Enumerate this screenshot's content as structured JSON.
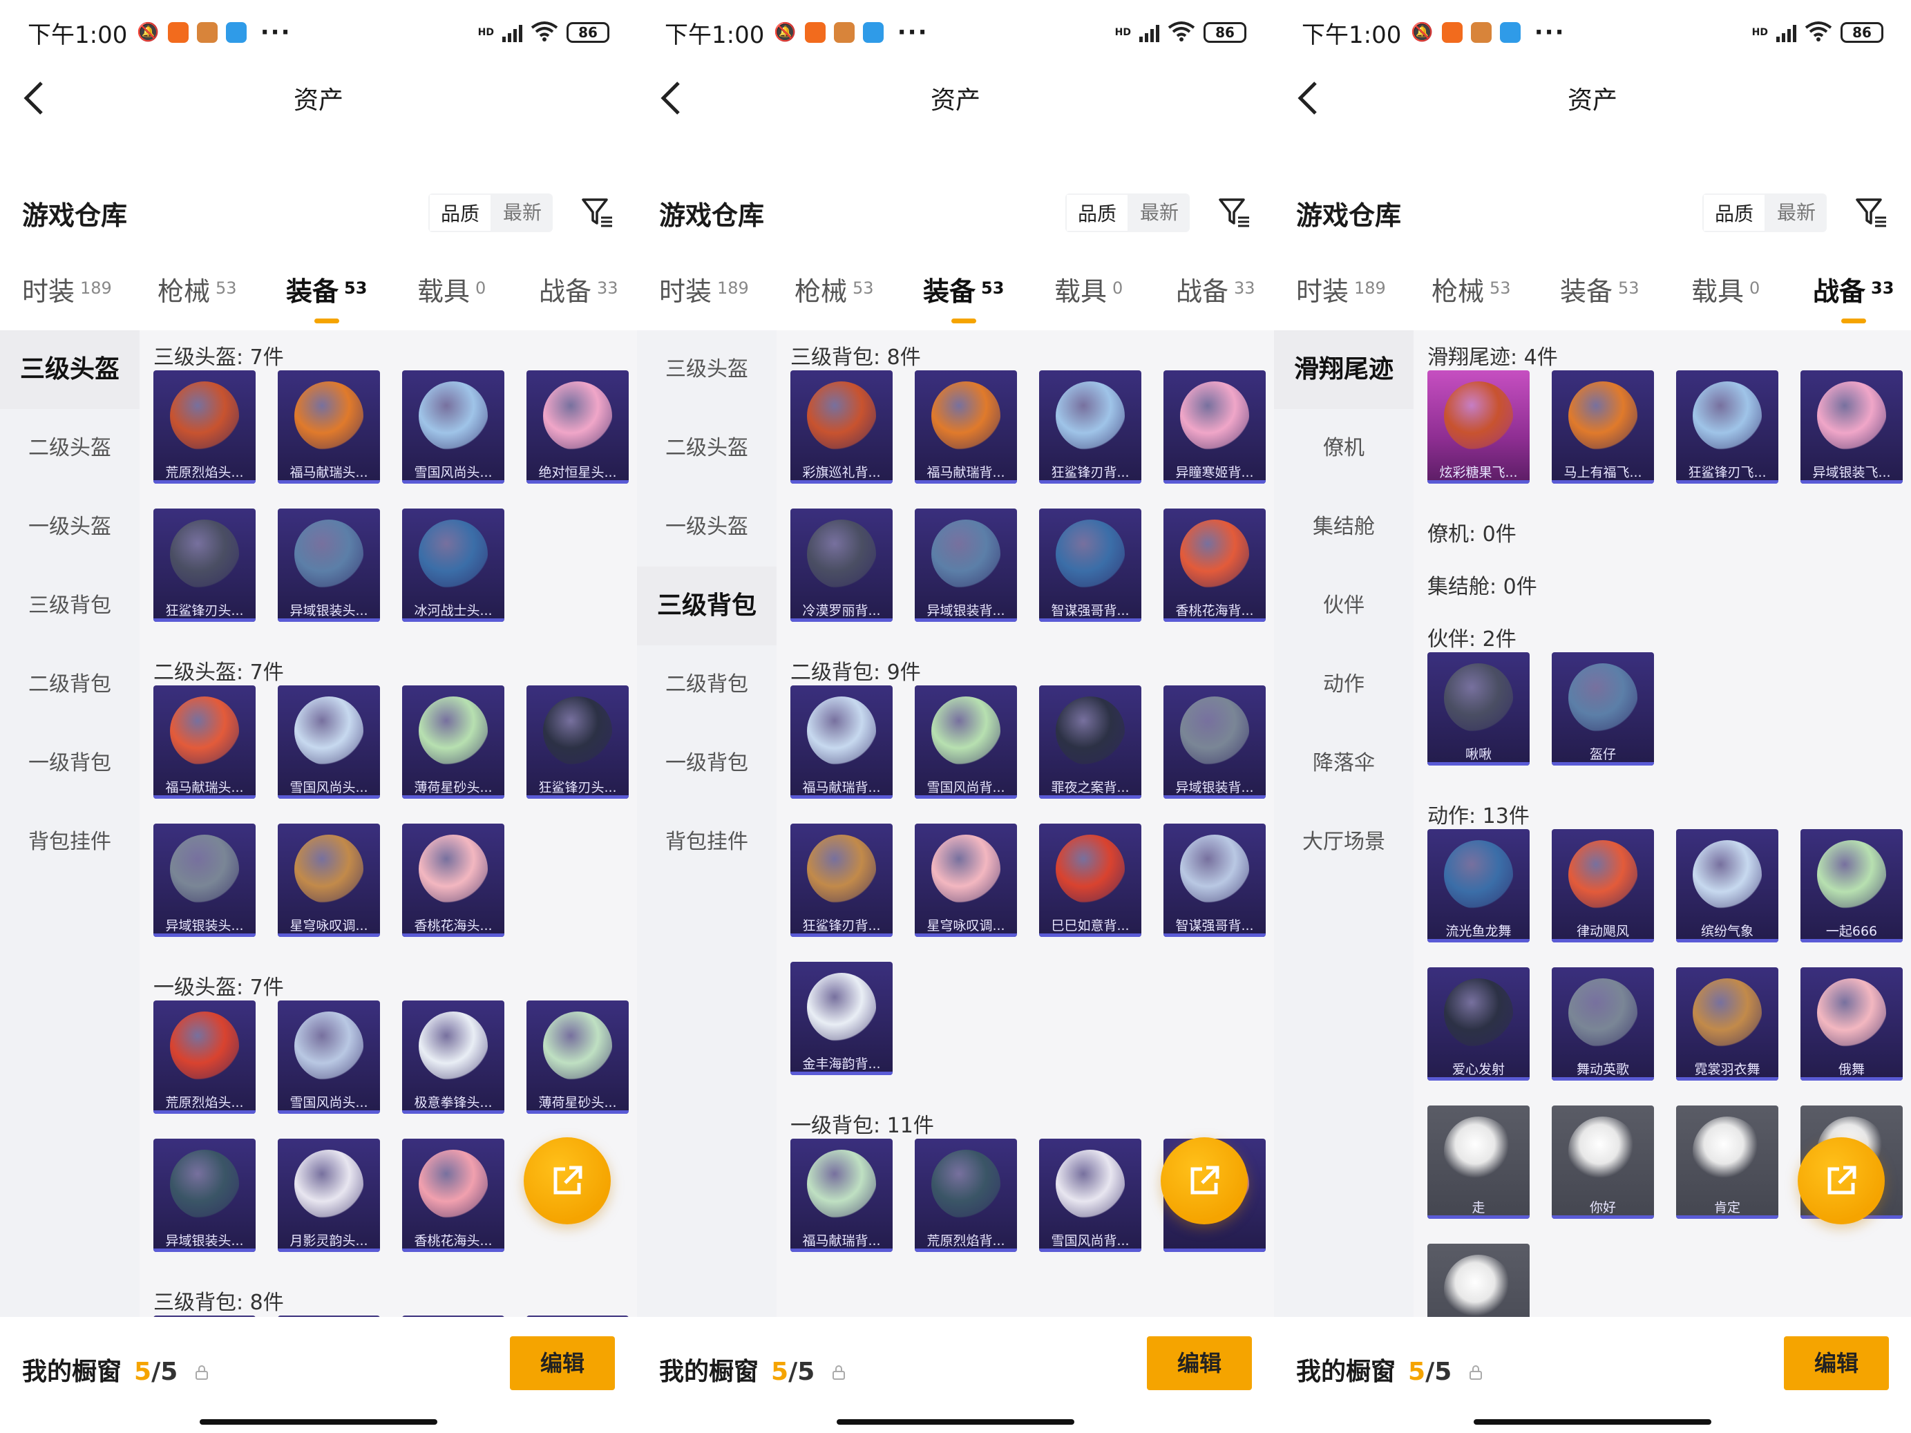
{
  "status": {
    "time": "下午1:00",
    "battery": "86",
    "network": "HD"
  },
  "nav": {
    "title": "资产"
  },
  "warehouse": {
    "title": "游戏仓库",
    "sort_quality": "品质",
    "sort_newest": "最新"
  },
  "tabs": [
    {
      "label": "时装",
      "count": "189"
    },
    {
      "label": "枪械",
      "count": "53"
    },
    {
      "label": "装备",
      "count": "53"
    },
    {
      "label": "载具",
      "count": "0"
    },
    {
      "label": "战备",
      "count": "33"
    }
  ],
  "equip_side": [
    "三级头盔",
    "二级头盔",
    "一级头盔",
    "三级背包",
    "二级背包",
    "一级背包",
    "背包挂件"
  ],
  "prep_side": [
    "滑翔尾迹",
    "僚机",
    "集结舱",
    "伙伴",
    "动作",
    "降落伞",
    "大厅场景"
  ],
  "panel1": {
    "sections": [
      {
        "title": "三级头盔: 7件",
        "items": [
          "荒原烈焰头...",
          "福马献瑞头...",
          "雪国风尚头...",
          "绝对恒星头...",
          "狂鲨锋刃头...",
          "异域银装头...",
          "冰河战士头..."
        ]
      },
      {
        "title": "二级头盔: 7件",
        "items": [
          "福马献瑞头...",
          "雪国风尚头...",
          "薄荷星砂头...",
          "狂鲨锋刃头...",
          "异域银装头...",
          "星穹咏叹调...",
          "香桃花海头..."
        ]
      },
      {
        "title": "一级头盔: 7件",
        "items": [
          "荒原烈焰头...",
          "雪国风尚头...",
          "极意拳锋头...",
          "薄荷星砂头...",
          "异域银装头...",
          "月影灵韵头...",
          "香桃花海头..."
        ]
      },
      {
        "title": "三级背包: 8件",
        "items": []
      }
    ]
  },
  "panel2": {
    "sections": [
      {
        "title": "三级背包: 8件",
        "items": [
          "彩旗巡礼背...",
          "福马献瑞背...",
          "狂鲨锋刃背...",
          "异瞳寒姬背...",
          "冷漠罗丽背...",
          "异域银装背...",
          "智谋强哥背...",
          "香桃花海背..."
        ]
      },
      {
        "title": "二级背包: 9件",
        "items": [
          "福马献瑞背...",
          "雪国风尚背...",
          "罪夜之案背...",
          "异域银装背...",
          "狂鲨锋刃背...",
          "星穹咏叹调...",
          "巳巳如意背...",
          "智谋强哥背...",
          "金丰海韵背..."
        ]
      },
      {
        "title": "一级背包: 11件",
        "items": [
          "福马献瑞背...",
          "荒原烈焰背...",
          "雪国风尚背...",
          ""
        ]
      }
    ]
  },
  "panel3": {
    "sections": [
      {
        "title": "滑翔尾迹: 4件",
        "items": [
          "炫彩糖果飞...",
          "马上有福飞...",
          "狂鲨锋刃飞...",
          "异域银装飞..."
        ]
      },
      {
        "title": "僚机: 0件",
        "items": []
      },
      {
        "title": "集结舱: 0件",
        "items": []
      },
      {
        "title": "伙伴: 2件",
        "items": [
          "啾啾",
          "盔仔"
        ]
      },
      {
        "title": "动作: 13件",
        "items": [
          "流光鱼龙舞",
          "律动飓风",
          "缤纷气象",
          "一起666",
          "爱心发射",
          "舞动英歌",
          "霓裳羽衣舞",
          "俄舞",
          "走",
          "你好",
          "肯定",
          "",
          ""
        ]
      }
    ]
  },
  "footer": {
    "label": "我的橱窗",
    "used": "5",
    "slash": "/",
    "total": "5",
    "edit": "编辑"
  },
  "colors": {
    "accent": "#f5a400",
    "card": "#2d2460",
    "card_pink": "#8e2e92"
  }
}
